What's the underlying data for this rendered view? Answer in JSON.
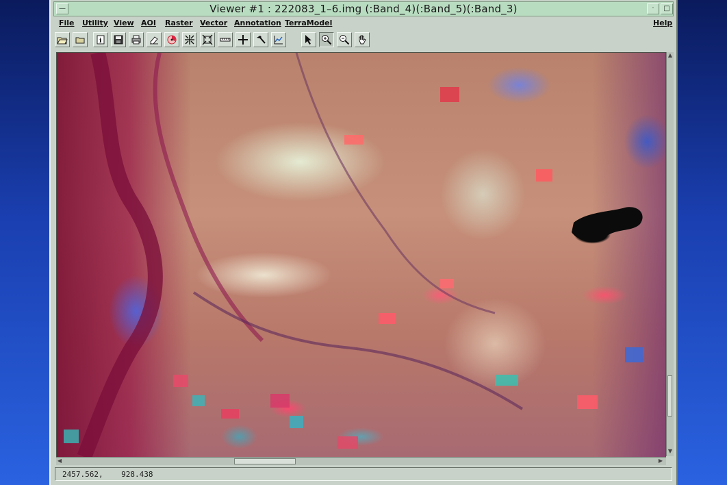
{
  "window": {
    "title": "Viewer #1 : 222083_1–6.img (:Band_4)(:Band_5)(:Band_3)"
  },
  "menu": {
    "items": [
      {
        "label": "File"
      },
      {
        "label": "Utility"
      },
      {
        "label": "View"
      },
      {
        "label": "AOI"
      },
      {
        "label": "Raster"
      },
      {
        "label": "Vector"
      },
      {
        "label": "Annotation"
      },
      {
        "label": "TerraModel"
      }
    ],
    "help_label": "Help"
  },
  "toolbar": {
    "tools": [
      {
        "icon": "open-folder-icon"
      },
      {
        "icon": "folder-icon"
      },
      {
        "icon": "info-icon"
      },
      {
        "icon": "save-icon"
      },
      {
        "icon": "print-icon"
      },
      {
        "icon": "eraser-icon"
      },
      {
        "icon": "color-wheel-icon"
      },
      {
        "icon": "zoom-fit-icon"
      },
      {
        "icon": "zoom-extent-icon"
      },
      {
        "icon": "measure-icon"
      },
      {
        "icon": "crosshair-icon"
      },
      {
        "icon": "hammer-icon"
      },
      {
        "icon": "profile-icon"
      },
      {
        "icon": "select-arrow-icon"
      },
      {
        "icon": "zoom-in-icon"
      },
      {
        "icon": "zoom-out-icon"
      },
      {
        "icon": "pan-hand-icon"
      }
    ]
  },
  "viewport": {
    "content": "satellite-image"
  },
  "status": {
    "x": "2457.562,",
    "y": "928.438"
  }
}
